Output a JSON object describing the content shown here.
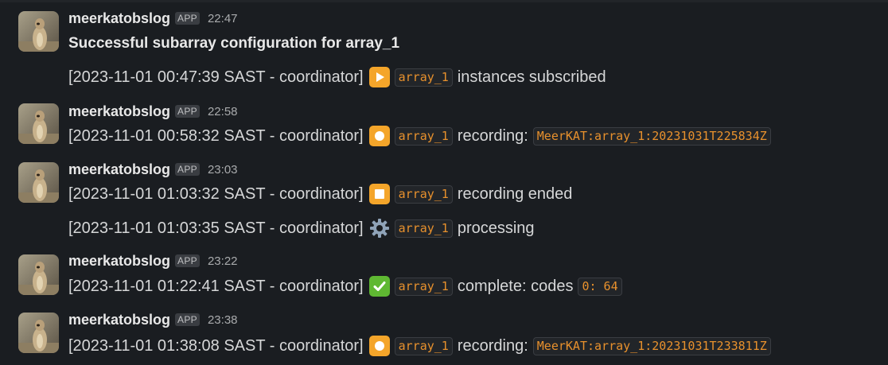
{
  "messages": [
    {
      "sender": "meerkatobslog",
      "badge": "APP",
      "time": "22:47",
      "lines": [
        {
          "type": "bold",
          "text": "Successful subarray configuration for array_1"
        },
        {
          "prefix": "[2023-11-01 00:47:39 SAST - coordinator]",
          "icon": "play-icon",
          "code": "array_1",
          "text": "instances subscribed"
        }
      ]
    },
    {
      "sender": "meerkatobslog",
      "badge": "APP",
      "time": "22:58",
      "lines": [
        {
          "prefix": "[2023-11-01 00:58:32 SAST - coordinator]",
          "icon": "record-icon",
          "code": "array_1",
          "text": "recording:",
          "code2": "MeerKAT:array_1:20231031T225834Z"
        }
      ]
    },
    {
      "sender": "meerkatobslog",
      "badge": "APP",
      "time": "23:03",
      "lines": [
        {
          "prefix": "[2023-11-01 01:03:32 SAST - coordinator]",
          "icon": "stop-icon",
          "code": "array_1",
          "text": "recording ended"
        },
        {
          "prefix": "[2023-11-01 01:03:35 SAST - coordinator]",
          "icon": "gear-icon",
          "code": "array_1",
          "text": "processing"
        }
      ]
    },
    {
      "sender": "meerkatobslog",
      "badge": "APP",
      "time": "23:22",
      "lines": [
        {
          "prefix": "[2023-11-01 01:22:41 SAST - coordinator]",
          "icon": "check-icon",
          "code": "array_1",
          "text": "complete: codes",
          "code2": "0: 64"
        }
      ]
    },
    {
      "sender": "meerkatobslog",
      "badge": "APP",
      "time": "23:38",
      "lines": [
        {
          "prefix": "[2023-11-01 01:38:08 SAST - coordinator]",
          "icon": "record-icon",
          "code": "array_1",
          "text": "recording:",
          "code2": "MeerKAT:array_1:20231031T233811Z"
        }
      ]
    }
  ]
}
